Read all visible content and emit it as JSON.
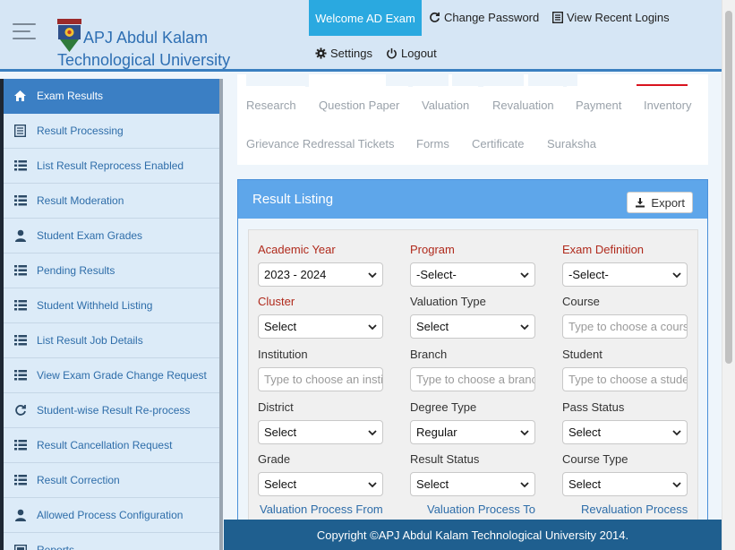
{
  "header": {
    "brand": "APJ Abdul Kalam Technological University",
    "welcome": "Welcome AD Exam",
    "change_password": "Change Password",
    "recent_logins": "View Recent Logins",
    "settings": "Settings",
    "logout": "Logout"
  },
  "sidebar": {
    "items": [
      {
        "label": "Exam Results",
        "icon": "home-icon"
      },
      {
        "label": "Result Processing",
        "icon": "document-list-icon"
      },
      {
        "label": "List Result Reprocess Enabled",
        "icon": "list-icon"
      },
      {
        "label": "Result Moderation",
        "icon": "list-icon"
      },
      {
        "label": "Student Exam Grades",
        "icon": "user-icon"
      },
      {
        "label": "Pending Results",
        "icon": "list-icon"
      },
      {
        "label": "Student Withheld Listing",
        "icon": "list-icon"
      },
      {
        "label": "List Result Job Details",
        "icon": "list-icon"
      },
      {
        "label": "View Exam Grade Change Request",
        "icon": "list-icon"
      },
      {
        "label": "Student-wise Result Re-process",
        "icon": "refresh-icon"
      },
      {
        "label": "Result Cancellation Request",
        "icon": "list-icon"
      },
      {
        "label": "Result Correction",
        "icon": "list-icon"
      },
      {
        "label": "Allowed Process Configuration",
        "icon": "user-icon"
      },
      {
        "label": "Reports",
        "icon": "report-icon"
      }
    ]
  },
  "tabs": {
    "row1": [
      "Research",
      "Question Paper",
      "Valuation",
      "Revaluation",
      "Payment",
      "Inventory"
    ],
    "row2": [
      "Grievance Redressal Tickets",
      "Forms",
      "Certificate",
      "Suraksha"
    ]
  },
  "panel": {
    "title": "Result Listing",
    "export": "Export"
  },
  "form": {
    "academic_year": {
      "label": "Academic Year",
      "value": "2023 - 2024"
    },
    "program": {
      "label": "Program",
      "value": "-Select-"
    },
    "exam_definition": {
      "label": "Exam Definition",
      "value": "-Select-"
    },
    "cluster": {
      "label": "Cluster",
      "value": "Select"
    },
    "valuation_type": {
      "label": "Valuation Type",
      "value": "Select"
    },
    "course": {
      "label": "Course",
      "placeholder": "Type to choose a course"
    },
    "institution": {
      "label": "Institution",
      "placeholder": "Type to choose an institution"
    },
    "branch": {
      "label": "Branch",
      "placeholder": "Type to choose a branch"
    },
    "student": {
      "label": "Student",
      "placeholder": "Type to choose a student"
    },
    "district": {
      "label": "District",
      "value": "Select"
    },
    "degree_type": {
      "label": "Degree Type",
      "value": "Regular"
    },
    "pass_status": {
      "label": "Pass Status",
      "value": "Select"
    },
    "grade": {
      "label": "Grade",
      "value": "Select"
    },
    "result_status": {
      "label": "Result Status",
      "value": "Select"
    },
    "course_type": {
      "label": "Course Type",
      "value": "Select"
    },
    "valuation_from": "Valuation Process From",
    "valuation_to": "Valuation Process To",
    "revaluation_process": "Revaluation Process"
  },
  "footer": "Copyright ©APJ Abdul Kalam Technological University 2014."
}
